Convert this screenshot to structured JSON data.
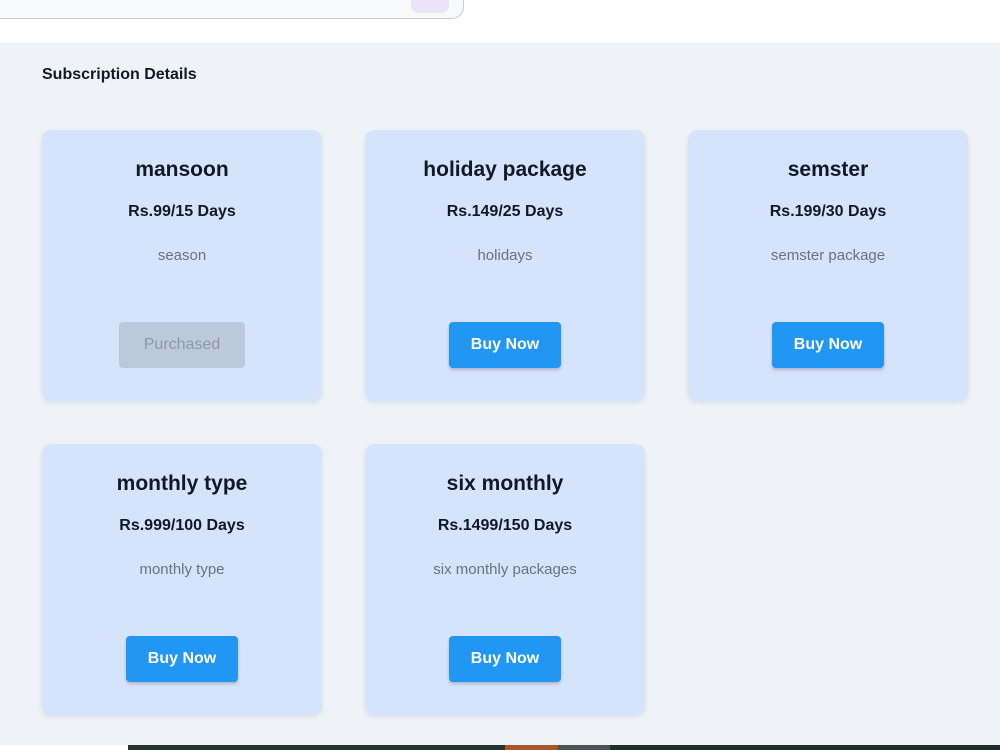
{
  "section": {
    "title": "Subscription Details"
  },
  "plans": [
    {
      "name": "mansoon",
      "price": "Rs.99/15 Days",
      "description": "season",
      "button_label": "Purchased",
      "purchased": true
    },
    {
      "name": "holiday package",
      "price": "Rs.149/25 Days",
      "description": "holidays",
      "button_label": "Buy Now",
      "purchased": false
    },
    {
      "name": "semster",
      "price": "Rs.199/30 Days",
      "description": "semster package",
      "button_label": "Buy Now",
      "purchased": false
    },
    {
      "name": "monthly type",
      "price": "Rs.999/100 Days",
      "description": "monthly type",
      "button_label": "Buy Now",
      "purchased": false
    },
    {
      "name": "six monthly",
      "price": "Rs.1499/150 Days",
      "description": "six monthly packages",
      "button_label": "Buy Now",
      "purchased": false
    }
  ],
  "colors": {
    "page_background": "#eff2f7",
    "card_background": "#d6e4fb",
    "primary_button": "#2196f3",
    "purchased_button": "#bcc8dc",
    "purchased_text": "#8e98a8"
  }
}
